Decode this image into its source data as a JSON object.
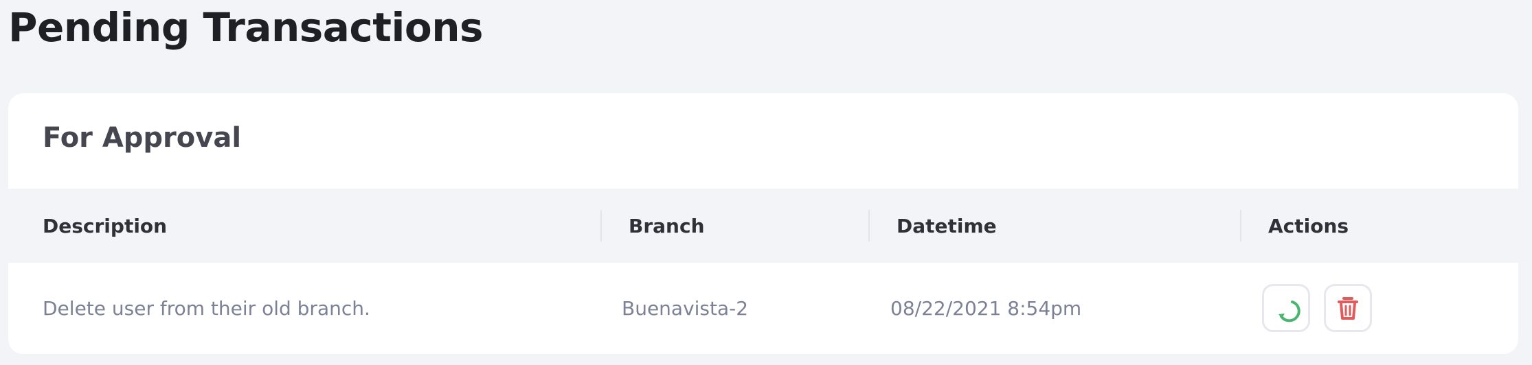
{
  "page": {
    "title": "Pending Transactions"
  },
  "card": {
    "title": "For Approval"
  },
  "table": {
    "columns": [
      "Description",
      "Branch",
      "Datetime",
      "Actions"
    ],
    "rows": [
      {
        "description": "Delete user from their old branch.",
        "branch": "Buenavista-2",
        "datetime": "08/22/2021 8:54pm",
        "actions": [
          {
            "icon": "refresh-icon",
            "color": "#49b46e"
          },
          {
            "icon": "trash-icon",
            "color": "#e25a5a"
          }
        ]
      }
    ]
  }
}
